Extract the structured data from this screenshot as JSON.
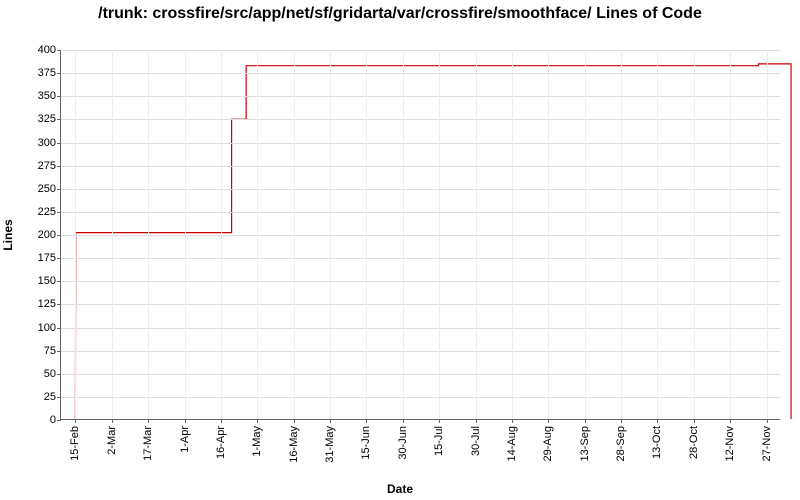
{
  "chart_data": {
    "type": "line",
    "title": "/trunk: crossfire/src/app/net/sf/gridarta/var/crossfire/smoothface/ Lines of Code",
    "xlabel": "Date",
    "ylabel": "Lines",
    "ylim": [
      0,
      400
    ],
    "y_ticks": [
      0,
      25,
      50,
      75,
      100,
      125,
      150,
      175,
      200,
      225,
      250,
      275,
      300,
      325,
      350,
      375,
      400
    ],
    "x_ticks": [
      "15-Feb",
      "2-Mar",
      "17-Mar",
      "1-Apr",
      "16-Apr",
      "1-May",
      "16-May",
      "31-May",
      "15-Jun",
      "30-Jun",
      "15-Jul",
      "30-Jul",
      "14-Aug",
      "29-Aug",
      "13-Sep",
      "28-Sep",
      "13-Oct",
      "28-Oct",
      "12-Nov",
      "27-Nov"
    ],
    "series": [
      {
        "name": "Lines of Code",
        "color": "#cc0000",
        "points": [
          {
            "xi": 0.0,
            "y": 0
          },
          {
            "xi": 0.01,
            "y": 202
          },
          {
            "xi": 4.3,
            "y": 202
          },
          {
            "xi": 4.3,
            "y": 325
          },
          {
            "xi": 4.7,
            "y": 325
          },
          {
            "xi": 4.7,
            "y": 383
          },
          {
            "xi": 18.8,
            "y": 383
          },
          {
            "xi": 18.8,
            "y": 385
          },
          {
            "xi": 19.7,
            "y": 385
          },
          {
            "xi": 19.7,
            "y": 0
          }
        ]
      }
    ]
  }
}
